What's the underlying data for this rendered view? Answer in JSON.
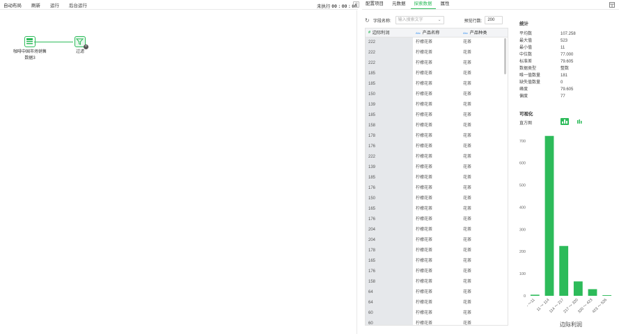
{
  "toolbar": {
    "buttons": [
      "自动布局",
      "刷新",
      "运行",
      "后台运行"
    ],
    "status_label": "未执行",
    "status_time": "00 : 00 : 00"
  },
  "canvas": {
    "nodes": [
      {
        "label_line1": "咖啡中国市场销售",
        "label_line2": "数据3"
      },
      {
        "label_line1": "过滤",
        "label_line2": ""
      }
    ]
  },
  "panel_tabs": {
    "items": [
      "配置项目",
      "元数据",
      "探索数据",
      "属性"
    ],
    "active_index": 2
  },
  "filter": {
    "field_label": "字段名称:",
    "search_placeholder": "输入搜索文字",
    "rows_label": "预览行数:",
    "rows_value": "200"
  },
  "table": {
    "columns": [
      {
        "type_icon": "#",
        "label": "边际利润"
      },
      {
        "type_icon": "Abc",
        "label": "产品名称"
      },
      {
        "type_icon": "Abc",
        "label": "产品种类"
      }
    ],
    "rows": [
      [
        "222",
        "柠檬花茶",
        "花茶"
      ],
      [
        "222",
        "柠檬花茶",
        "花茶"
      ],
      [
        "222",
        "柠檬花茶",
        "花茶"
      ],
      [
        "185",
        "柠檬花茶",
        "花茶"
      ],
      [
        "185",
        "柠檬花茶",
        "花茶"
      ],
      [
        "150",
        "柠檬花茶",
        "花茶"
      ],
      [
        "139",
        "柠檬花茶",
        "花茶"
      ],
      [
        "185",
        "柠檬花茶",
        "花茶"
      ],
      [
        "158",
        "柠檬花茶",
        "花茶"
      ],
      [
        "178",
        "柠檬花茶",
        "花茶"
      ],
      [
        "176",
        "柠檬花茶",
        "花茶"
      ],
      [
        "222",
        "柠檬花茶",
        "花茶"
      ],
      [
        "139",
        "柠檬花茶",
        "花茶"
      ],
      [
        "185",
        "柠檬花茶",
        "花茶"
      ],
      [
        "176",
        "柠檬花茶",
        "花茶"
      ],
      [
        "150",
        "柠檬花茶",
        "花茶"
      ],
      [
        "165",
        "柠檬花茶",
        "花茶"
      ],
      [
        "176",
        "柠檬花茶",
        "花茶"
      ],
      [
        "204",
        "柠檬花茶",
        "花茶"
      ],
      [
        "204",
        "柠檬花茶",
        "花茶"
      ],
      [
        "178",
        "柠檬花茶",
        "花茶"
      ],
      [
        "165",
        "柠檬花茶",
        "花茶"
      ],
      [
        "176",
        "柠檬花茶",
        "花茶"
      ],
      [
        "158",
        "柠檬花茶",
        "花茶"
      ],
      [
        "64",
        "柠檬花茶",
        "花茶"
      ],
      [
        "64",
        "柠檬花茶",
        "花茶"
      ],
      [
        "60",
        "柠檬花茶",
        "花茶"
      ],
      [
        "60",
        "柠檬花茶",
        "花茶"
      ]
    ]
  },
  "stats": {
    "title": "统计",
    "rows": [
      {
        "k": "平均数",
        "v": "107.258"
      },
      {
        "k": "最大值",
        "v": "523"
      },
      {
        "k": "最小值",
        "v": "11"
      },
      {
        "k": "中位数",
        "v": "77.000"
      },
      {
        "k": "标准差",
        "v": "79.605"
      },
      {
        "k": "数据类型",
        "v": "整数"
      },
      {
        "k": "唯一值数量",
        "v": "181"
      },
      {
        "k": "缺失值数量",
        "v": "0"
      },
      {
        "k": "峰度",
        "v": "79.605"
      },
      {
        "k": "偏度",
        "v": "77"
      }
    ]
  },
  "visualization": {
    "title": "可视化",
    "type_label": "直方图",
    "accent_color": "#2dbb5a"
  },
  "chart_data": {
    "type": "bar",
    "categories": [
      "- ～11",
      "11 ～ 114",
      "114 ～ 217",
      "217 ～ 320",
      "320 ～ 423",
      "423 ～ 526"
    ],
    "values": [
      5,
      722,
      225,
      65,
      30,
      3
    ],
    "xlabel": "边际利润",
    "ylabel": "",
    "ylim": [
      0,
      740
    ],
    "yticks": [
      0,
      100,
      200,
      300,
      400,
      500,
      600,
      700
    ],
    "color": "#2dbb5a"
  }
}
